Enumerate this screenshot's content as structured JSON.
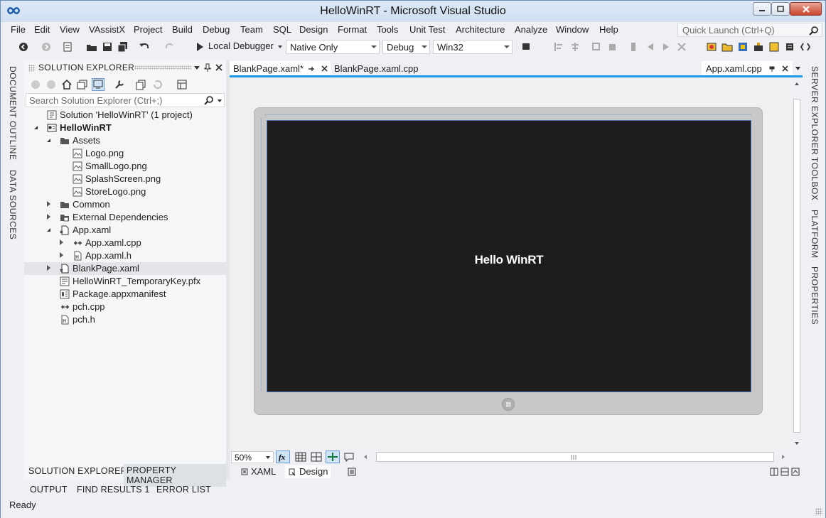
{
  "window": {
    "title": "HelloWinRT - Microsoft Visual Studio"
  },
  "menu": {
    "items": [
      "File",
      "Edit",
      "View",
      "VAssistX",
      "Project",
      "Build",
      "Debug",
      "Team",
      "SQL",
      "Design",
      "Format",
      "Tools",
      "Unit Test",
      "Architecture",
      "Analyze",
      "Window",
      "Help"
    ],
    "quick_launch_placeholder": "Quick Launch (Ctrl+Q)"
  },
  "toolbar": {
    "run_label": "Local Debugger",
    "debugger_type": "Native Only",
    "configuration": "Debug",
    "platform": "Win32"
  },
  "left_side_tabs": [
    "DOCUMENT OUTLINE",
    "DATA SOURCES"
  ],
  "right_side_tabs": [
    "SERVER EXPLORER",
    "TOOLBOX",
    "PLATFORM",
    "PROPERTIES"
  ],
  "solution_explorer": {
    "title": "SOLUTION EXPLORER",
    "search_placeholder": "Search Solution Explorer (Ctrl+;)",
    "tree": [
      {
        "label": "Solution 'HelloWinRT' (1 project)",
        "depth": 0,
        "expander": "none",
        "icon": "solution-icon",
        "bold": false
      },
      {
        "label": "HelloWinRT",
        "depth": 0,
        "expander": "open",
        "icon": "project-icon",
        "bold": true
      },
      {
        "label": "Assets",
        "depth": 1,
        "expander": "open",
        "icon": "folder-icon",
        "bold": false
      },
      {
        "label": "Logo.png",
        "depth": 2,
        "expander": "none",
        "icon": "image-file-icon",
        "bold": false
      },
      {
        "label": "SmallLogo.png",
        "depth": 2,
        "expander": "none",
        "icon": "image-file-icon",
        "bold": false
      },
      {
        "label": "SplashScreen.png",
        "depth": 2,
        "expander": "none",
        "icon": "image-file-icon",
        "bold": false
      },
      {
        "label": "StoreLogo.png",
        "depth": 2,
        "expander": "none",
        "icon": "image-file-icon",
        "bold": false
      },
      {
        "label": "Common",
        "depth": 1,
        "expander": "closed",
        "icon": "folder-icon",
        "bold": false
      },
      {
        "label": "External Dependencies",
        "depth": 1,
        "expander": "closed",
        "icon": "dependencies-icon",
        "bold": false
      },
      {
        "label": "App.xaml",
        "depth": 1,
        "expander": "open",
        "icon": "xaml-file-icon",
        "bold": false
      },
      {
        "label": "App.xaml.cpp",
        "depth": 2,
        "expander": "closed",
        "icon": "cpp-file-icon",
        "bold": false
      },
      {
        "label": "App.xaml.h",
        "depth": 2,
        "expander": "closed",
        "icon": "header-file-icon",
        "bold": false
      },
      {
        "label": "BlankPage.xaml",
        "depth": 1,
        "expander": "closed",
        "icon": "xaml-file-icon",
        "bold": false,
        "selected": true
      },
      {
        "label": "HelloWinRT_TemporaryKey.pfx",
        "depth": 1,
        "expander": "none",
        "icon": "certificate-file-icon",
        "bold": false
      },
      {
        "label": "Package.appxmanifest",
        "depth": 1,
        "expander": "none",
        "icon": "manifest-file-icon",
        "bold": false
      },
      {
        "label": "pch.cpp",
        "depth": 1,
        "expander": "none",
        "icon": "cpp-file-icon",
        "bold": false
      },
      {
        "label": "pch.h",
        "depth": 1,
        "expander": "none",
        "icon": "header-file-icon",
        "bold": false
      }
    ],
    "bottom_tabs": [
      "SOLUTION EXPLORER",
      "PROPERTY MANAGER"
    ]
  },
  "editor": {
    "tabs": [
      "BlankPage.xaml*",
      "BlankPage.xaml.cpp"
    ],
    "right_tab": "App.xaml.cpp",
    "design_text": "Hello WinRT",
    "zoom": "50%",
    "view_tabs": [
      "XAML",
      "Design"
    ]
  },
  "bottom_tool_tabs": [
    "OUTPUT",
    "FIND RESULTS 1",
    "ERROR LIST"
  ],
  "status": {
    "text": "Ready"
  },
  "colors": {
    "accent": "#1c97ea",
    "design_surface": "#1d1d1d",
    "device_frame": "#c8c8c8"
  }
}
